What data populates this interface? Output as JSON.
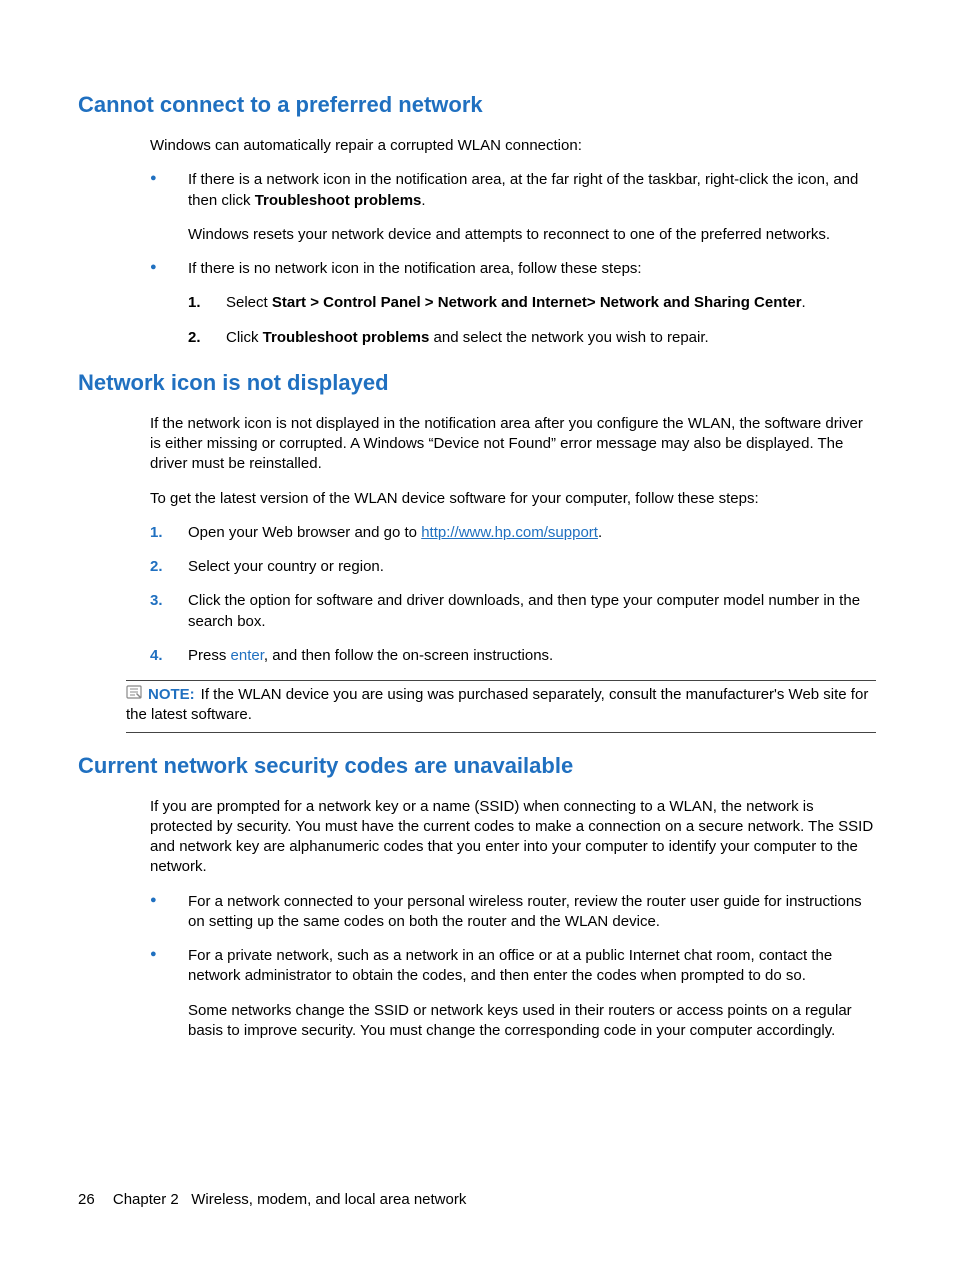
{
  "section1": {
    "heading": "Cannot connect to a preferred network",
    "intro": "Windows can automatically repair a corrupted WLAN connection:",
    "bullet1_pre": "If there is a network icon in the notification area, at the far right of the taskbar, right-click the icon, and then click ",
    "bullet1_bold": "Troubleshoot problems",
    "bullet1_post": ".",
    "bullet1_para": "Windows resets your network device and attempts to reconnect to one of the preferred networks.",
    "bullet2_text": "If there is no network icon in the notification area, follow these steps:",
    "step1_pre": "Select ",
    "step1_bold": "Start > Control Panel > Network and Internet> Network and Sharing Center",
    "step1_post": ".",
    "step2_pre": "Click ",
    "step2_bold": "Troubleshoot problems",
    "step2_post": " and select the network you wish to repair.",
    "num1": "1.",
    "num2": "2."
  },
  "section2": {
    "heading": "Network icon is not displayed",
    "para1": "If the network icon is not displayed in the notification area after you configure the WLAN, the software driver is either missing or corrupted. A Windows “Device not Found” error message may also be displayed. The driver must be reinstalled.",
    "para2": "To get the latest version of the WLAN device software for your computer, follow these steps:",
    "step1_pre": "Open your Web browser and go to ",
    "step1_link": "http://www.hp.com/support",
    "step1_post": ".",
    "step2": "Select your country or region.",
    "step3": "Click the option for software and driver downloads, and then type your computer model number in the search box.",
    "step4_pre": "Press ",
    "step4_key": "enter",
    "step4_post": ", and then follow the on-screen instructions.",
    "num1": "1.",
    "num2": "2.",
    "num3": "3.",
    "num4": "4.",
    "note_label": "NOTE:",
    "note_text": "If the WLAN device you are using was purchased separately, consult the manufacturer's Web site for the latest software."
  },
  "section3": {
    "heading": "Current network security codes are unavailable",
    "para1": "If you are prompted for a network key or a name (SSID) when connecting to a WLAN, the network is protected by security. You must have the current codes to make a connection on a secure network. The SSID and network key are alphanumeric codes that you enter into your computer to identify your computer to the network.",
    "bullet1": "For a network connected to your personal wireless router, review the router user guide for instructions on setting up the same codes on both the router and the WLAN device.",
    "bullet2": "For a private network, such as a network in an office or at a public Internet chat room, contact the network administrator to obtain the codes, and then enter the codes when prompted to do so.",
    "bullet2_para": "Some networks change the SSID or network keys used in their routers or access points on a regular basis to improve security. You must change the corresponding code in your computer accordingly."
  },
  "footer": {
    "page": "26",
    "chapter": "Chapter 2   Wireless, modem, and local area network"
  }
}
